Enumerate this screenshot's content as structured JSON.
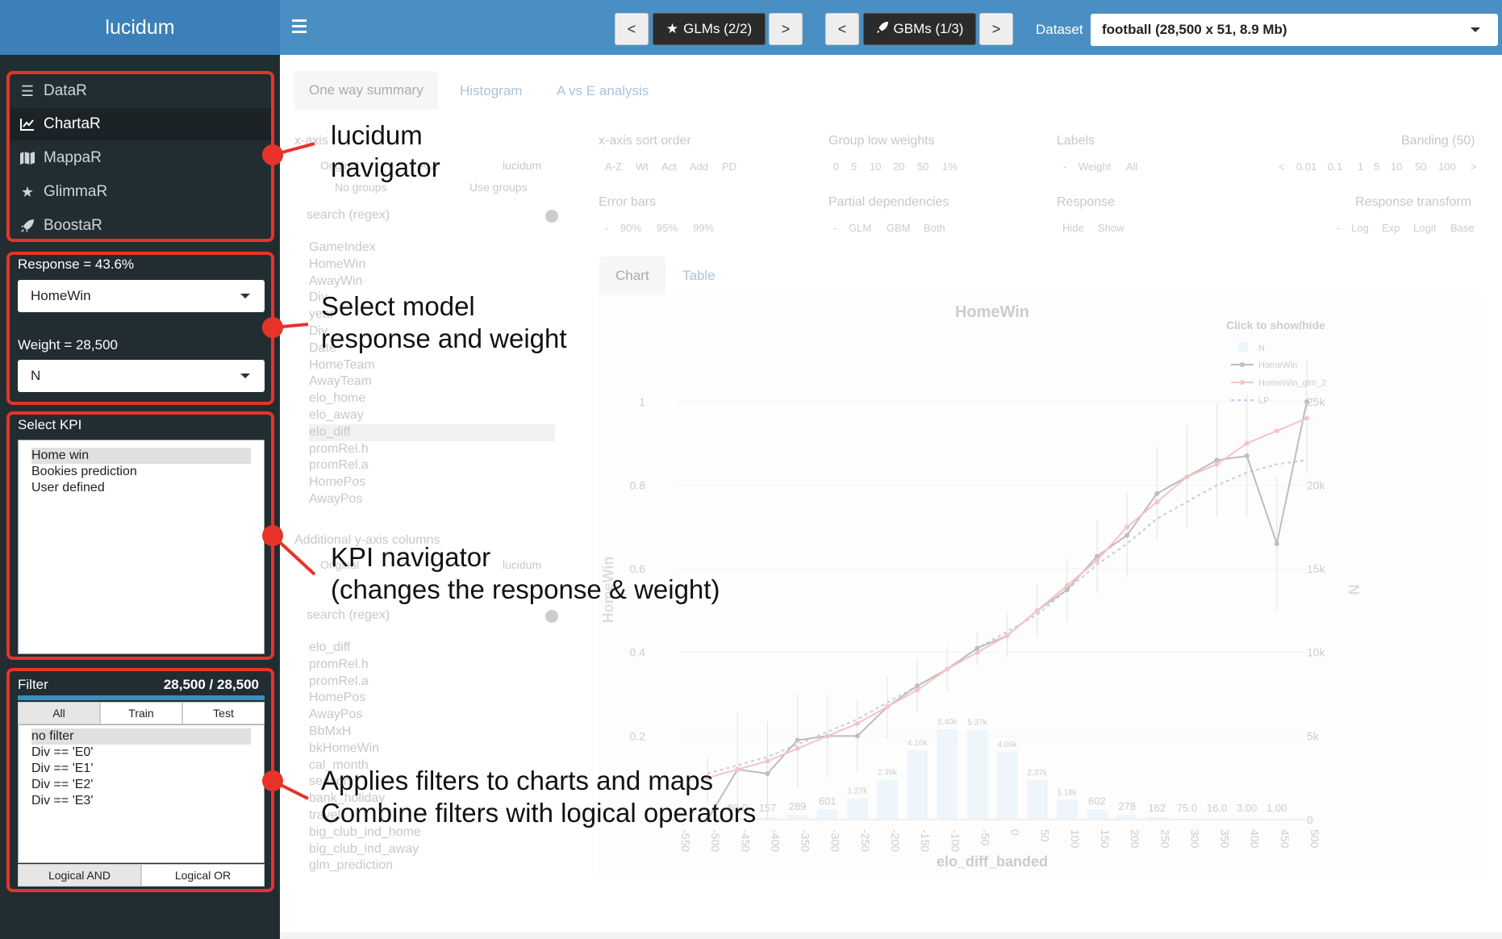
{
  "app": {
    "brand": "lucidum"
  },
  "topbar": {
    "prev_glm": "<",
    "glm_label": "GLMs (2/2)",
    "next_glm": ">",
    "prev_gbm": "<",
    "gbm_label": "GBMs (1/3)",
    "next_gbm": ">",
    "dataset_label": "Dataset",
    "dataset_value": "football (28,500 x 51, 8.9 Mb)"
  },
  "sidebar": {
    "menu": [
      {
        "label": "DataR",
        "icon": "list-icon"
      },
      {
        "label": "ChartaR",
        "icon": "line-chart-icon"
      },
      {
        "label": "MappaR",
        "icon": "map-icon"
      },
      {
        "label": "GlimmaR",
        "icon": "star-icon"
      },
      {
        "label": "BoostaR",
        "icon": "rocket-icon"
      }
    ],
    "response_label": "Response = 43.6%",
    "response_value": "HomeWin",
    "weight_label": "Weight = 28,500",
    "weight_value": "N",
    "kpi_label": "Select KPI",
    "kpi_items": [
      "Home win",
      "Bookies prediction",
      "User defined"
    ],
    "filter_label": "Filter",
    "filter_count": "28,500 / 28,500",
    "filter_tabs": [
      "All",
      "Train",
      "Test"
    ],
    "filter_items": [
      "no filter",
      "Div == 'E0'",
      "Div == 'E1'",
      "Div == 'E2'",
      "Div == 'E3'"
    ],
    "logic_and": "Logical AND",
    "logic_or": "Logical OR"
  },
  "main": {
    "tabs": [
      "One way summary",
      "Histogram",
      "A vs E analysis"
    ],
    "xaxis_label": "x-axis",
    "xaxis_opts": [
      "Original",
      "A-Z",
      "lucidum"
    ],
    "group_opts": [
      "No groups",
      "Use groups"
    ],
    "search_placeholder": "search (regex)",
    "columns": [
      "GameIndex",
      "HomeWin",
      "AwayWin",
      "Div",
      "year",
      "Div",
      "Date",
      "HomeTeam",
      "AwayTeam",
      "elo_home",
      "elo_away",
      "elo_diff",
      "promRel.h",
      "promRel.a",
      "HomePos",
      "AwayPos"
    ],
    "additional_label": "Additional y-axis columns",
    "additional_columns": [
      "elo_diff",
      "promRel.h",
      "promRel.a",
      "HomePos",
      "AwayPos",
      "BbMxH",
      "bkHomeWin",
      "cal_month",
      "season",
      "bank_holiday",
      "travel",
      "big_club_ind_home",
      "big_club_ind_away",
      "glm_prediction"
    ],
    "sort_label": "x-axis sort order",
    "sort_opts": [
      "A-Z",
      "Wt",
      "Act",
      "Add",
      "PD"
    ],
    "group_low_label": "Group low weights",
    "group_low_opts": [
      "0",
      "5",
      "10",
      "20",
      "50",
      "1%"
    ],
    "labels_label": "Labels",
    "labels_opts": [
      "-",
      "Weight",
      "All"
    ],
    "banding_label": "Banding (50)",
    "banding_opts": [
      "<",
      "0.01",
      "0.1",
      "1",
      "5",
      "10",
      "50",
      "100",
      ">"
    ],
    "errorbars_label": "Error bars",
    "errorbars_opts": [
      "-",
      "90%",
      "95%",
      "99%"
    ],
    "pd_label": "Partial dependencies",
    "pd_opts": [
      "-",
      "GLM",
      "GBM",
      "Both"
    ],
    "response_label": "Response",
    "response_opts": [
      "Hide",
      "Show"
    ],
    "transform_label": "Response transform",
    "transform_opts": [
      "-",
      "Log",
      "Exp",
      "Logit",
      "Base"
    ],
    "chart_tabs": [
      "Chart",
      "Table"
    ]
  },
  "annotations": {
    "nav": [
      "lucidum",
      "navigator"
    ],
    "model": [
      "Select model",
      "response and weight"
    ],
    "kpi": [
      "KPI navigator",
      "(changes the response & weight)"
    ],
    "filter": [
      "Applies filters to charts and maps",
      "Combine filters with logical operators"
    ]
  },
  "chart_data": {
    "type": "line",
    "title": "HomeWin",
    "xlabel": "elo_diff_banded",
    "ylabel": "HomeWin",
    "y2label": "N",
    "legend_title": "Click to show/hide",
    "legend": [
      "N",
      "HomeWin",
      "HomeWin_glm_2",
      "LP"
    ],
    "categories": [
      "-550",
      "-500",
      "-450",
      "-400",
      "-350",
      "-300",
      "-250",
      "-200",
      "-150",
      "-100",
      "-50",
      "0",
      "50",
      "100",
      "150",
      "200",
      "250",
      "300",
      "350",
      "400",
      "450",
      "500"
    ],
    "yticks": [
      "0.2",
      "0.4",
      "0.6",
      "0.8",
      "1"
    ],
    "y2ticks": [
      "0",
      "5k",
      "10k",
      "15k",
      "20k",
      "25k"
    ],
    "ylim": [
      0,
      1.1
    ],
    "y2lim": [
      0,
      27500
    ],
    "series": [
      {
        "name": "HomeWin",
        "values": [
          null,
          0.0,
          0.12,
          0.11,
          0.19,
          0.2,
          0.2,
          0.27,
          0.32,
          0.36,
          0.41,
          0.44,
          0.5,
          0.55,
          0.63,
          0.68,
          0.78,
          0.82,
          0.86,
          0.87,
          0.66,
          1.0
        ]
      },
      {
        "name": "HomeWin_glm_2",
        "values": [
          null,
          0.1,
          0.12,
          0.14,
          0.17,
          0.2,
          0.23,
          0.27,
          0.31,
          0.36,
          0.4,
          0.44,
          0.5,
          0.56,
          0.62,
          0.7,
          0.76,
          0.82,
          0.85,
          0.9,
          0.93,
          0.96
        ]
      },
      {
        "name": "LP",
        "values": [
          null,
          0.11,
          0.13,
          0.15,
          0.18,
          0.21,
          0.24,
          0.28,
          0.32,
          0.36,
          0.41,
          0.45,
          0.49,
          0.55,
          0.61,
          0.66,
          0.72,
          0.76,
          0.8,
          0.83,
          0.85,
          0.86
        ]
      },
      {
        "name": "N",
        "values": [
          0,
          0,
          80,
          157,
          289,
          601,
          1270,
          2390,
          4160,
          5400,
          5370,
          4060,
          2370,
          1180,
          602,
          278,
          162,
          75,
          16,
          3,
          1,
          0
        ]
      }
    ],
    "bar_labels": [
      "",
      "",
      "80.0",
      "157",
      "289",
      "601",
      "1.27k",
      "2.39k",
      "4.16k",
      "5.40k",
      "5.37k",
      "4.06k",
      "2.37k",
      "1.18k",
      "602",
      "278",
      "162",
      "75.0",
      "16.0",
      "3.00",
      "1.00",
      ""
    ]
  }
}
